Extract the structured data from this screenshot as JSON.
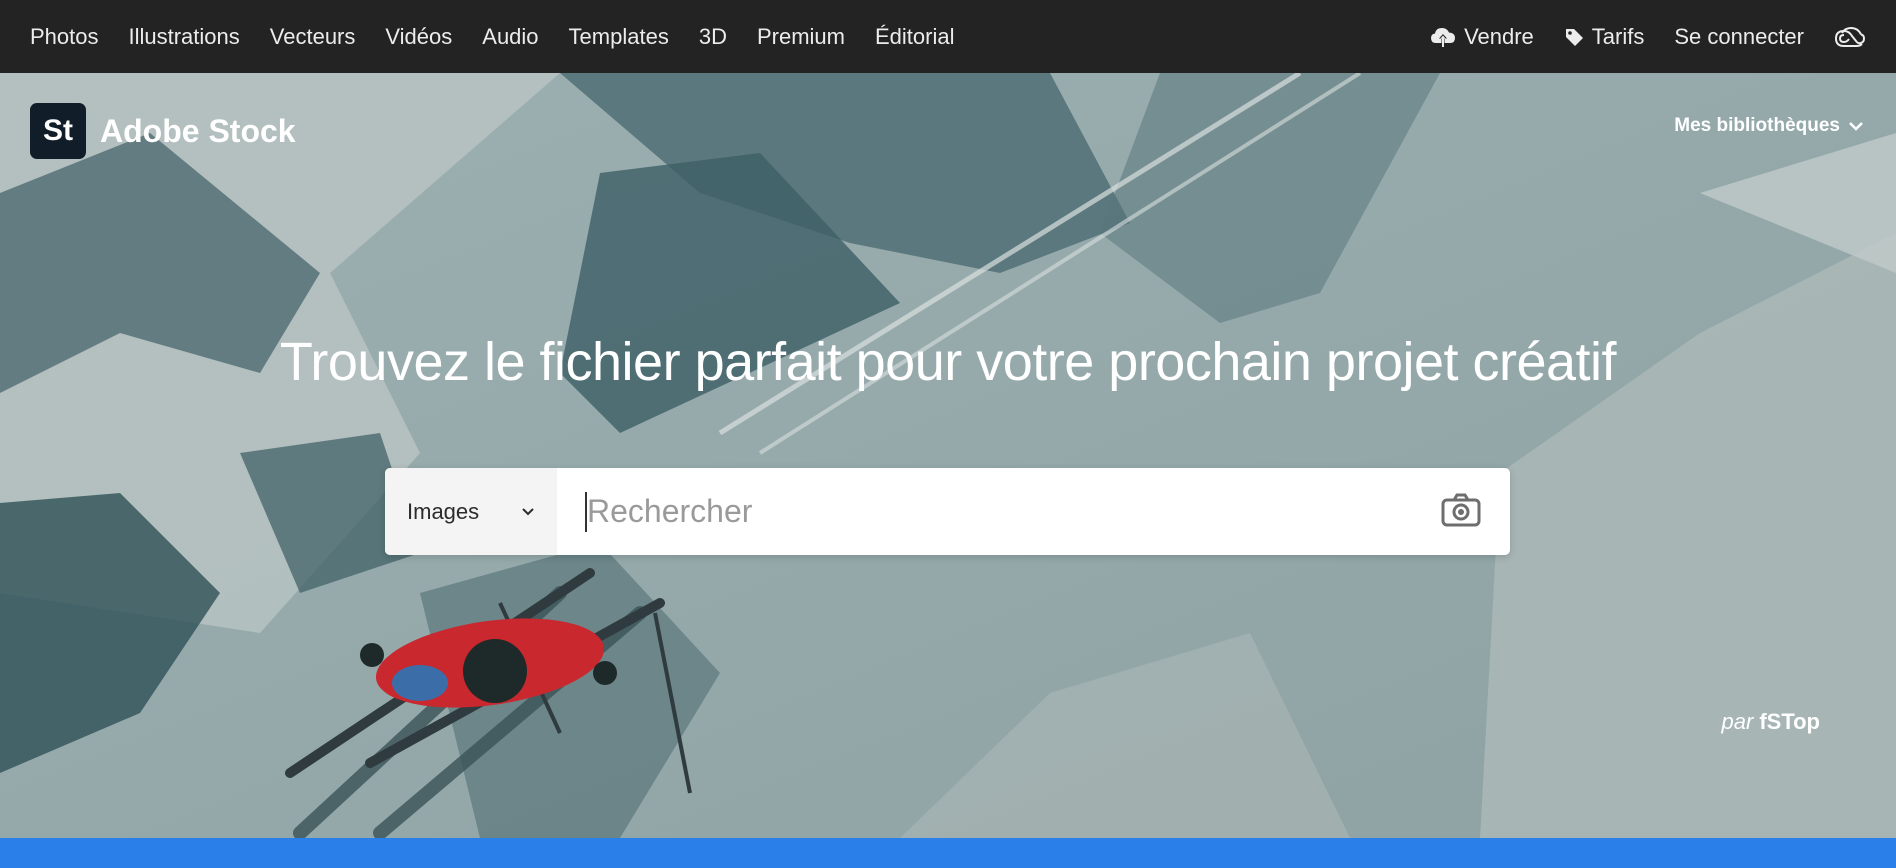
{
  "nav": {
    "left_items": [
      {
        "label": "Photos"
      },
      {
        "label": "Illustrations"
      },
      {
        "label": "Vecteurs"
      },
      {
        "label": "Vidéos"
      },
      {
        "label": "Audio"
      },
      {
        "label": "Templates"
      },
      {
        "label": "3D"
      },
      {
        "label": "Premium"
      },
      {
        "label": "Éditorial"
      }
    ],
    "sell": {
      "label": "Vendre",
      "icon": "cloud-upload-icon"
    },
    "pricing": {
      "label": "Tarifs",
      "icon": "tag-icon"
    },
    "signin": {
      "label": "Se connecter"
    },
    "cc_icon": "creative-cloud-icon"
  },
  "brand": {
    "logo_text": "St",
    "name": "Adobe Stock"
  },
  "libraries": {
    "label": "Mes bibliothèques",
    "icon": "chevron-down-icon"
  },
  "hero": {
    "headline": "Trouvez le fichier parfait pour votre prochain projet créatif",
    "credit_prefix": "par",
    "credit_author": "fSTop"
  },
  "search": {
    "type_label": "Images",
    "placeholder": "Rechercher",
    "value": "",
    "camera_icon": "camera-icon"
  },
  "colors": {
    "nav_bg": "#232323",
    "hero_bg": "#8fa3a5",
    "accent_bar": "#2b7fe8",
    "logo_bg": "#121d2a"
  }
}
